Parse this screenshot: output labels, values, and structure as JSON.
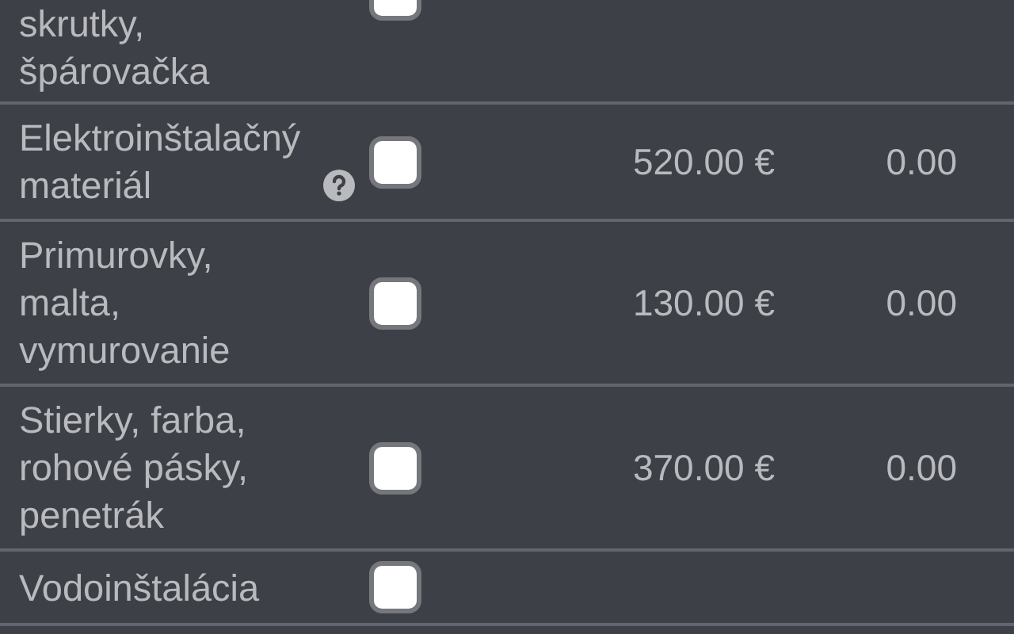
{
  "rows": [
    {
      "name": "skrutky, špárovačka",
      "help": false,
      "checked": false,
      "price": "",
      "amount": ""
    },
    {
      "name": "Elektroinštalačný materiál",
      "help": true,
      "checked": false,
      "price": "520.00 €",
      "amount": "0.00"
    },
    {
      "name": "Primurovky, malta, vymurovanie",
      "help": false,
      "checked": false,
      "price": "130.00 €",
      "amount": "0.00"
    },
    {
      "name": "Stierky, farba, rohové pásky, penetrák",
      "help": false,
      "checked": false,
      "price": "370.00 €",
      "amount": "0.00"
    },
    {
      "name": "Vodoinštalácia",
      "help": false,
      "checked": false,
      "price": "",
      "amount": ""
    }
  ]
}
